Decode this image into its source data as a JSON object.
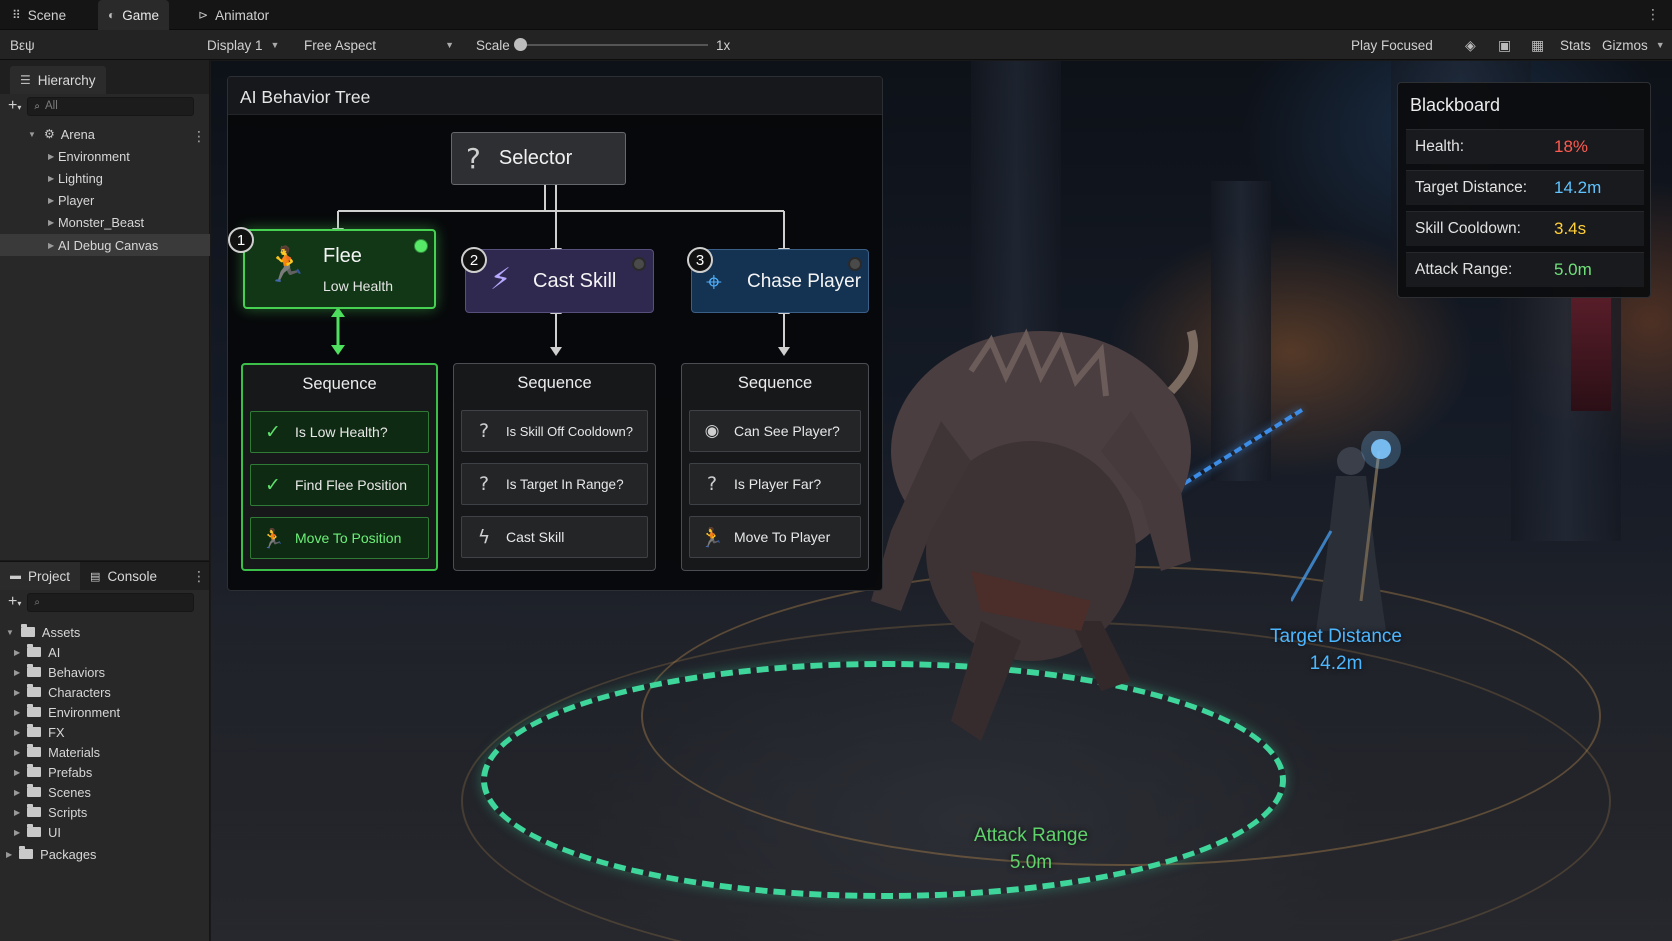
{
  "editor": {
    "tabs": [
      {
        "label": "Scene",
        "icon": "grid-icon"
      },
      {
        "label": "Game",
        "icon": "gamepad-icon"
      },
      {
        "label": "Animator",
        "icon": "animator-icon"
      }
    ],
    "toolbar": {
      "left_label": "Bεψ",
      "display": "Display 1",
      "aspect": "Free Aspect",
      "scale_label": "Scale",
      "scale_value": "1x",
      "play_focused": "Play Focused",
      "stats": "Stats",
      "gizmos": "Gizmos"
    }
  },
  "hierarchy": {
    "title": "Hierarchy",
    "search_placeholder": "All",
    "root": "Arena",
    "items": [
      "Environment",
      "Lighting",
      "Player",
      "Monster_Beast",
      "AI Debug Canvas"
    ],
    "selected": "AI Debug Canvas"
  },
  "project": {
    "tabs": [
      "Project",
      "Console"
    ],
    "root": "Assets",
    "folders": [
      "AI",
      "Behaviors",
      "Characters",
      "Environment",
      "FX",
      "Materials",
      "Prefabs",
      "Scenes",
      "Scripts",
      "UI"
    ],
    "packages": "Packages"
  },
  "behavior_tree": {
    "title": "AI Behavior Tree",
    "selector": "Selector",
    "branches": [
      {
        "number": "1",
        "title": "Flee",
        "subtitle": "Low Health",
        "state": "active",
        "icon": "running-icon",
        "sequence": "Sequence",
        "rows": [
          {
            "label": "Is Low Health?",
            "icon": "check-icon"
          },
          {
            "label": "Find Flee Position",
            "icon": "check-icon"
          },
          {
            "label": "Move To Position",
            "icon": "running-icon"
          }
        ]
      },
      {
        "number": "2",
        "title": "Cast Skill",
        "state": "idle",
        "icon": "lightning-icon",
        "sequence": "Sequence",
        "rows": [
          {
            "label": "Is Skill Off Cooldown?",
            "icon": "question-icon"
          },
          {
            "label": "Is Target In Range?",
            "icon": "question-icon"
          },
          {
            "label": "Cast Skill",
            "icon": "lightning-icon"
          }
        ]
      },
      {
        "number": "3",
        "title": "Chase Player",
        "state": "idle",
        "icon": "crosshair-icon",
        "sequence": "Sequence",
        "rows": [
          {
            "label": "Can See Player?",
            "icon": "eye-icon"
          },
          {
            "label": "Is Player Far?",
            "icon": "question-icon"
          },
          {
            "label": "Move To Player",
            "icon": "running-icon"
          }
        ]
      }
    ]
  },
  "blackboard": {
    "title": "Blackboard",
    "rows": [
      {
        "key": "Health:",
        "value": "18%",
        "color": "#ff5a4f"
      },
      {
        "key": "Target Distance:",
        "value": "14.2m",
        "color": "#5fc4ff"
      },
      {
        "key": "Skill Cooldown:",
        "value": "3.4s",
        "color": "#ffcf3a"
      },
      {
        "key": "Attack Range:",
        "value": "5.0m",
        "color": "#6fe07a"
      }
    ]
  },
  "world_labels": {
    "target_distance": {
      "title": "Target Distance",
      "value": "14.2m",
      "color": "#4cb6ff"
    },
    "attack_range": {
      "title": "Attack Range",
      "value": "5.0m",
      "color": "#5fd36b"
    }
  },
  "colors": {
    "active_green": "#35c94a",
    "cast_purple": "#332c55",
    "chase_blue": "#15314f",
    "ring_teal": "#3ed69a"
  }
}
